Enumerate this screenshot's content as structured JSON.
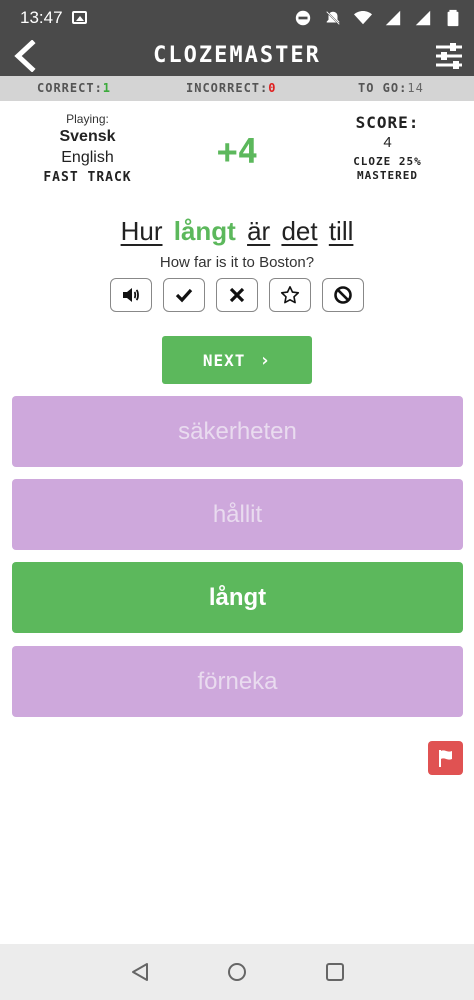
{
  "status_bar": {
    "time": "13:47",
    "icons": [
      "image-icon",
      "dnd-icon",
      "mute-icon",
      "wifi-icon",
      "signal-icon",
      "signal-icon-2",
      "battery-icon"
    ]
  },
  "header": {
    "title": "CLOZEMASTER",
    "back_icon": "chevron-left-icon",
    "settings_icon": "sliders-icon"
  },
  "stats": {
    "correct_label": "CORRECT:",
    "correct_value": "1",
    "incorrect_label": "INCORRECT:",
    "incorrect_value": "0",
    "to_go_label": "TO GO:",
    "to_go_value": "14"
  },
  "playing": {
    "label": "Playing:",
    "language": "Svensk",
    "native_language": "English",
    "mode": "FAST TRACK"
  },
  "points": "+4",
  "score": {
    "label": "SCORE:",
    "value": "4",
    "cloze_line1": "CLOZE 25%",
    "cloze_line2": "MASTERED"
  },
  "sentence": {
    "words": [
      "Hur",
      "långt",
      "är",
      "det",
      "till"
    ],
    "answer_index": 1,
    "translation": "How far is it to Boston?"
  },
  "actions": [
    "speaker-icon",
    "check-icon",
    "x-icon",
    "star-icon",
    "block-icon"
  ],
  "next_button": {
    "label": "NEXT",
    "chevron": "›"
  },
  "choices": [
    {
      "label": "säkerheten",
      "state": "disabled"
    },
    {
      "label": "hållit",
      "state": "disabled"
    },
    {
      "label": "långt",
      "state": "correct"
    },
    {
      "label": "förneka",
      "state": "disabled"
    }
  ],
  "colors": {
    "accent_green": "#5cb85c",
    "choice_purple": "#cea8dc",
    "flag_red": "#e05252",
    "header_gray": "#4a4a4a"
  }
}
